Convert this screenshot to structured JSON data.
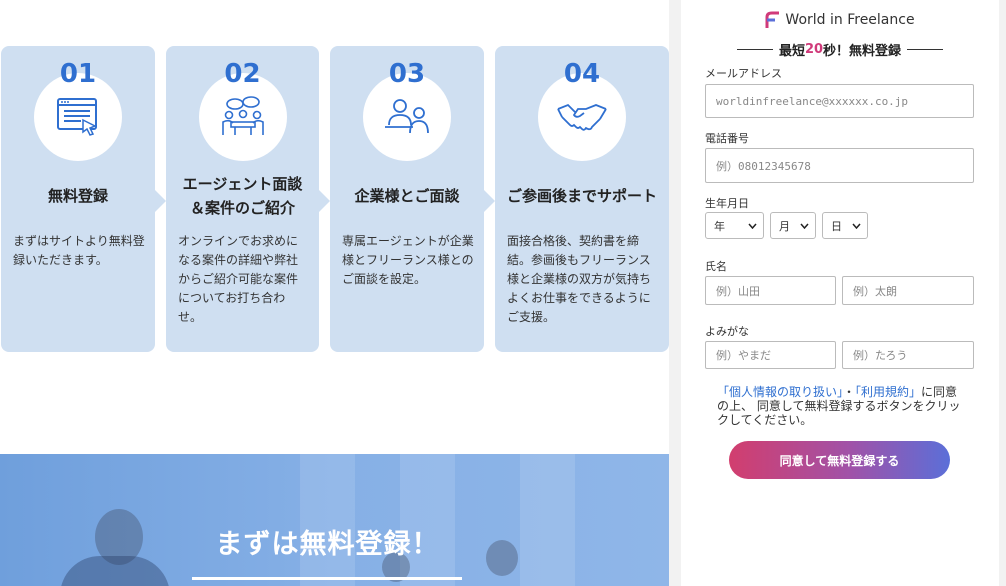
{
  "steps": [
    {
      "num": "01",
      "title": "無料登録",
      "desc": "まずはサイトより無料登録いただきます。",
      "icon": "browser-form-icon"
    },
    {
      "num": "02",
      "title": "エージェント面談\n＆案件のご紹介",
      "desc": "オンラインでお求めになる案件の詳細や弊社からご紹介可能な案件についてお打ち合わせ。",
      "icon": "meeting-table-icon"
    },
    {
      "num": "03",
      "title": "企業様とご面談",
      "desc": "専属エージェントが企業様とフリーランス様とのご面談を設定。",
      "icon": "interview-icon"
    },
    {
      "num": "04",
      "title": "ご参画後までサポート",
      "desc": "面接合格後、契約書を締結。参画後もフリーランス様と企業様の双方が気持ちよくお仕事をできるようにご支援。",
      "icon": "handshake-icon"
    }
  ],
  "banner": {
    "headline": "まずは無料登録！"
  },
  "form": {
    "logo_text": "World in Freelance",
    "tagline_pre": "最短",
    "tagline_num": "20",
    "tagline_post": "秒！無料登録",
    "email_label": "メールアドレス",
    "email_placeholder": "worldinfreelance@xxxxxx.co.jp",
    "phone_label": "電話番号",
    "phone_placeholder": "例）08012345678",
    "birth_label": "生年月日",
    "year": "年",
    "month": "月",
    "day": "日",
    "name_label": "氏名",
    "last_name_placeholder": "例）山田",
    "first_name_placeholder": "例）太朗",
    "kana_label": "よみがな",
    "last_kana_placeholder": "例）やまだ",
    "first_kana_placeholder": "例）たろう",
    "privacy_link": "「個人情報の取り扱い」",
    "dot": "・",
    "terms_link": "「利用規約」",
    "agree_text": "に同意の上、 同意して無料登録するボタンをクリックしてください。",
    "submit_label": "同意して無料登録する"
  },
  "colors": {
    "accent": "#2f6fd0",
    "card": "#cfdff1",
    "pink": "#d03a7a"
  }
}
